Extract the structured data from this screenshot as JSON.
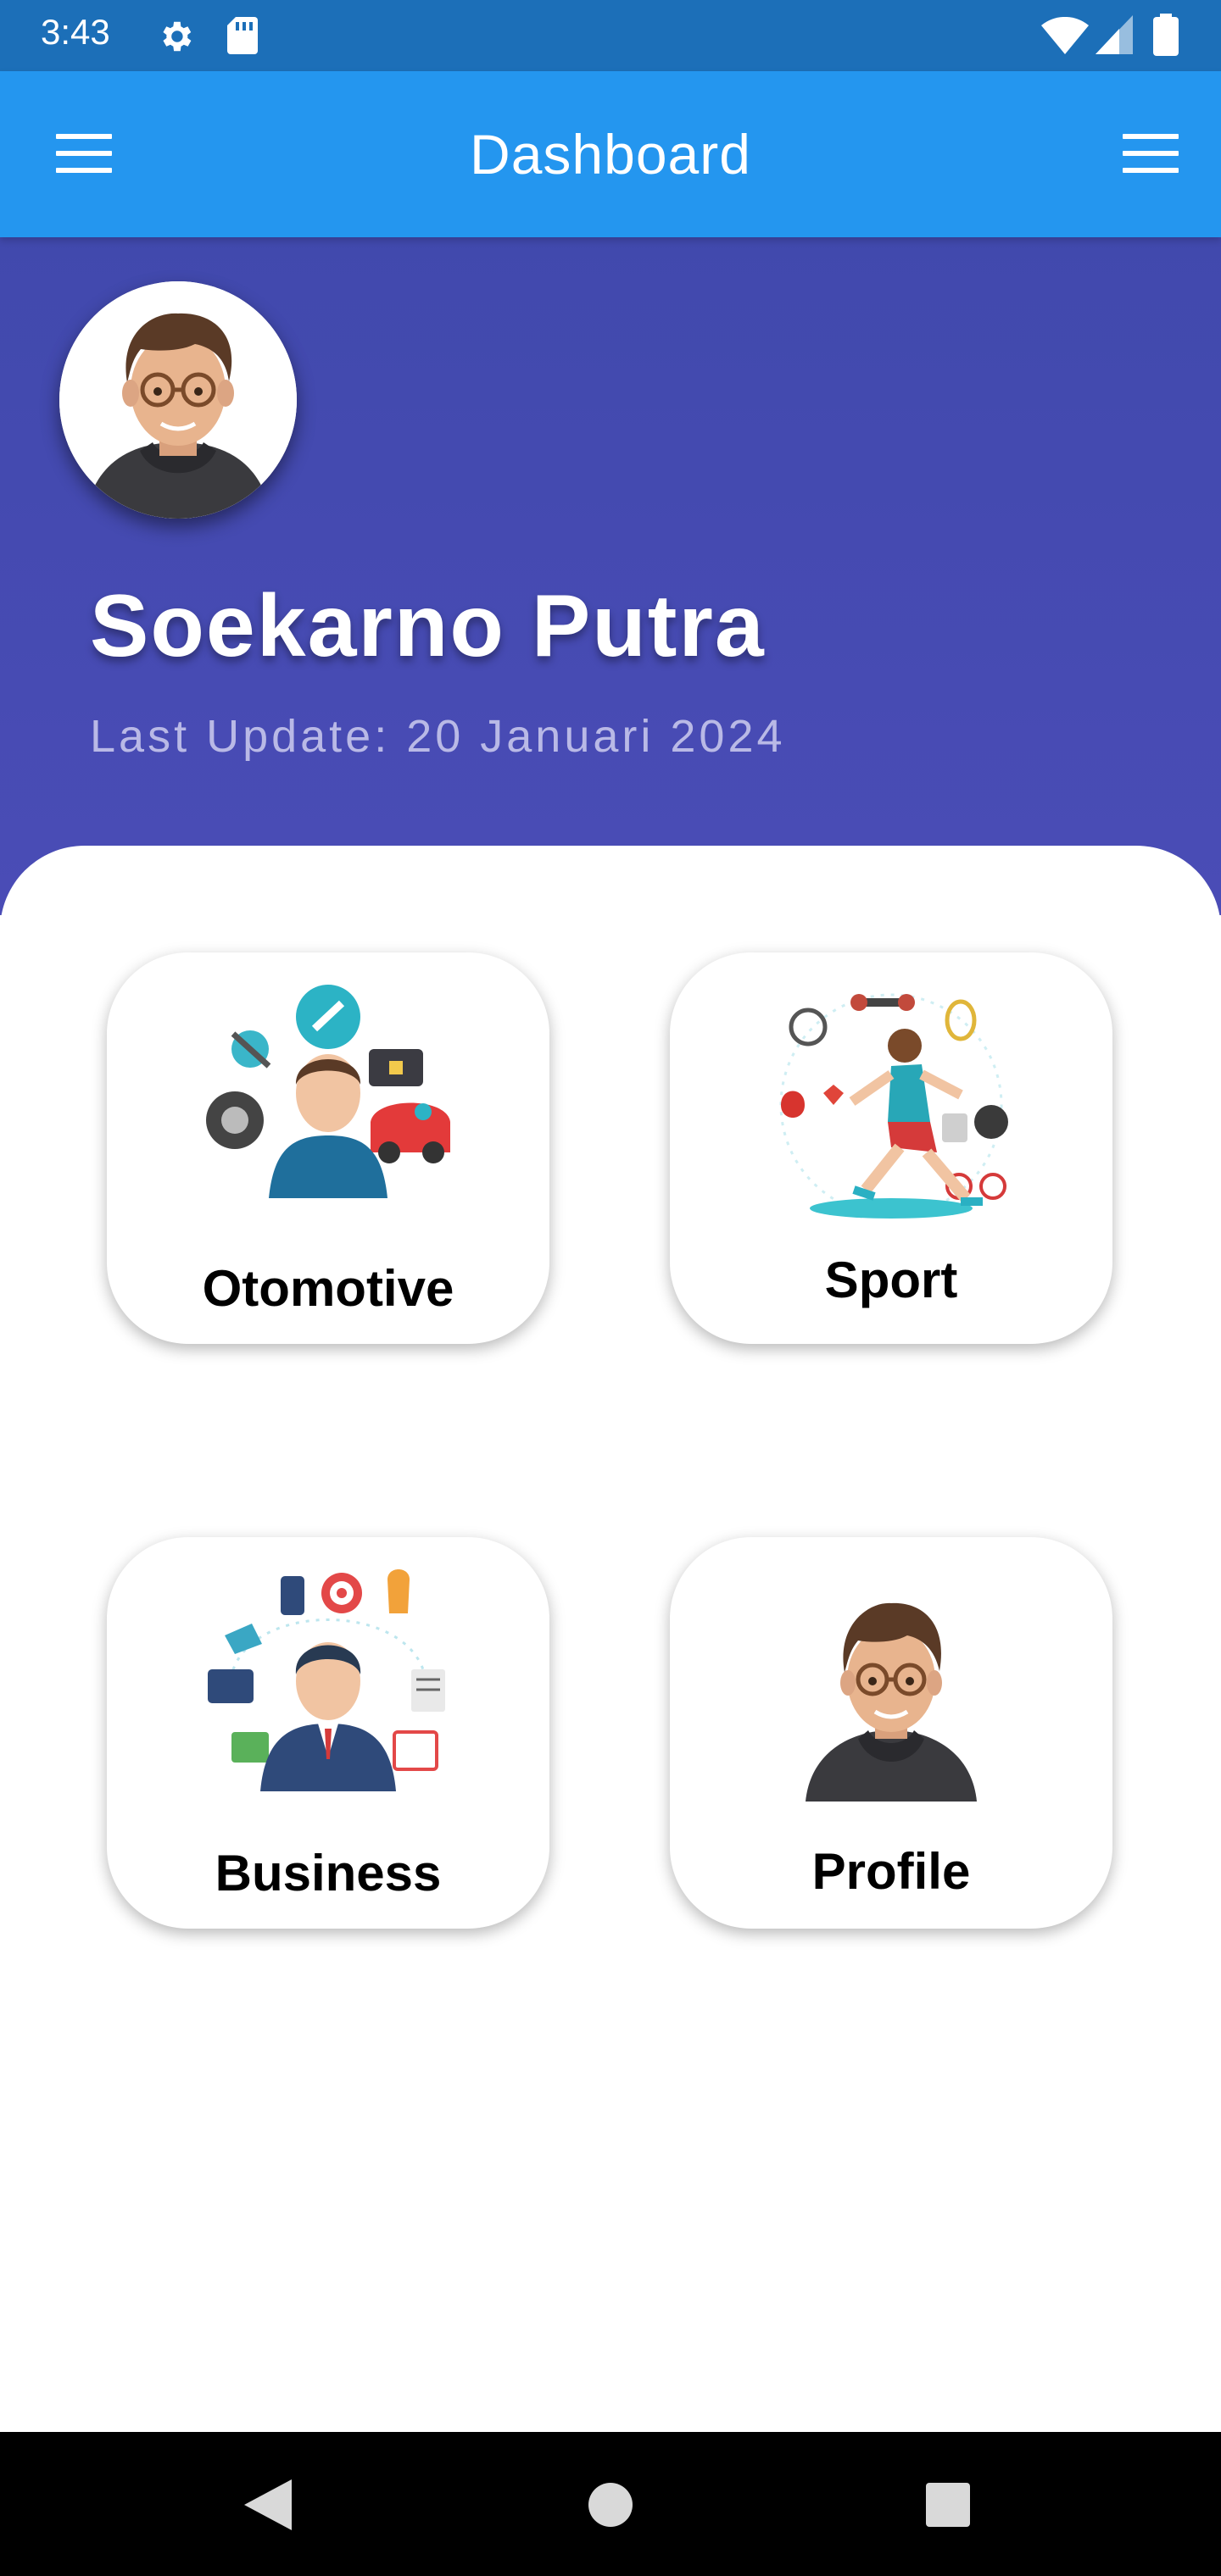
{
  "status_bar": {
    "time": "3:43",
    "icons": [
      "gear-icon",
      "sd-card-icon",
      "wifi-icon",
      "signal-icon",
      "battery-icon"
    ]
  },
  "app_bar": {
    "title": "Dashboard",
    "left_icon": "menu-icon",
    "right_icon": "menu-icon",
    "color": "#2496ef"
  },
  "header": {
    "name": "Soekarno Putra",
    "last_update": "Last Update: 20 Januari 2024",
    "color": "#4149ad"
  },
  "menu": {
    "items": [
      {
        "label": "Otomotive",
        "icon": "automotive-illustration"
      },
      {
        "label": "Sport",
        "icon": "sport-illustration"
      },
      {
        "label": "Business",
        "icon": "business-illustration"
      },
      {
        "label": "Profile",
        "icon": "profile-avatar-illustration"
      }
    ]
  },
  "nav_bar": {
    "buttons": [
      "back-icon",
      "home-icon",
      "recents-icon"
    ]
  }
}
